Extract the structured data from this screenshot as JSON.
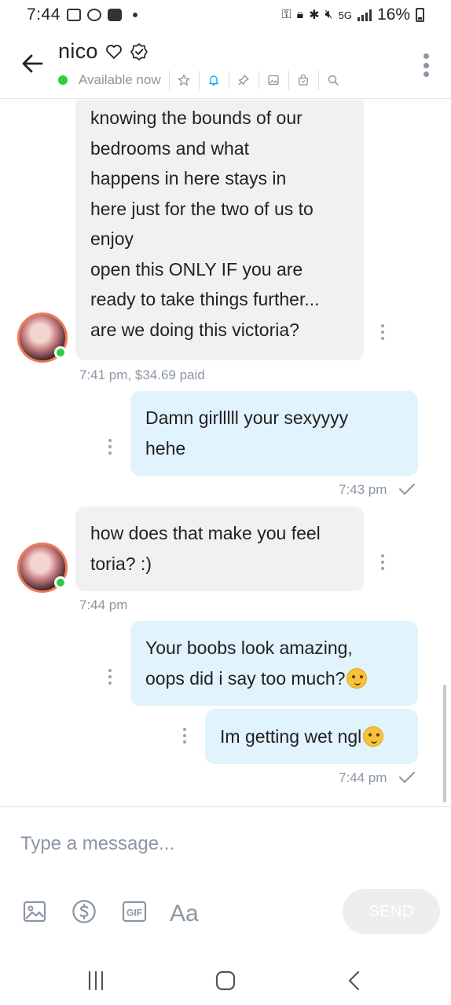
{
  "status_bar": {
    "time": "7:44",
    "network": "5G",
    "battery": "16%"
  },
  "header": {
    "contact_name": "nico",
    "status": "Available now",
    "actions": [
      "star-icon",
      "bell-icon",
      "pin-icon",
      "image-icon",
      "bag-icon",
      "search-icon"
    ]
  },
  "messages": [
    {
      "direction": "incoming",
      "lines": [
        "knowing the bounds of our",
        "bedrooms and what",
        "happens in here stays in",
        "here just for the two of us to",
        "enjoy",
        "open this ONLY IF you are",
        "ready to take things further...",
        "are we doing this victoria?"
      ],
      "meta": "7:41 pm,  $34.69 paid"
    },
    {
      "direction": "outgoing",
      "lines": [
        "Damn girlllll your sexyyyy",
        "hehe"
      ],
      "meta": "7:43 pm"
    },
    {
      "direction": "incoming",
      "lines": [
        "how does that make you feel",
        "toria? :)"
      ],
      "meta": "7:44 pm"
    },
    {
      "direction": "outgoing",
      "lines": [
        "Your boobs look amazing,",
        "oops did i say too much?"
      ],
      "emoji": "shushing-face-icon"
    },
    {
      "direction": "outgoing",
      "lines": [
        "Im getting wet ngl"
      ],
      "emoji": "shushing-face-icon",
      "meta": "7:44 pm"
    }
  ],
  "composer": {
    "placeholder": "Type a message...",
    "send_label": "SEND",
    "tools": [
      "image-icon",
      "dollar-icon",
      "gif-icon",
      "text-format-icon"
    ]
  },
  "colors": {
    "incoming_bubble": "#f0f1f3",
    "outgoing_bubble": "#e1f3fc",
    "online": "#2ecc40",
    "meta_text": "#8a96a3",
    "accent": "#00aff0"
  }
}
